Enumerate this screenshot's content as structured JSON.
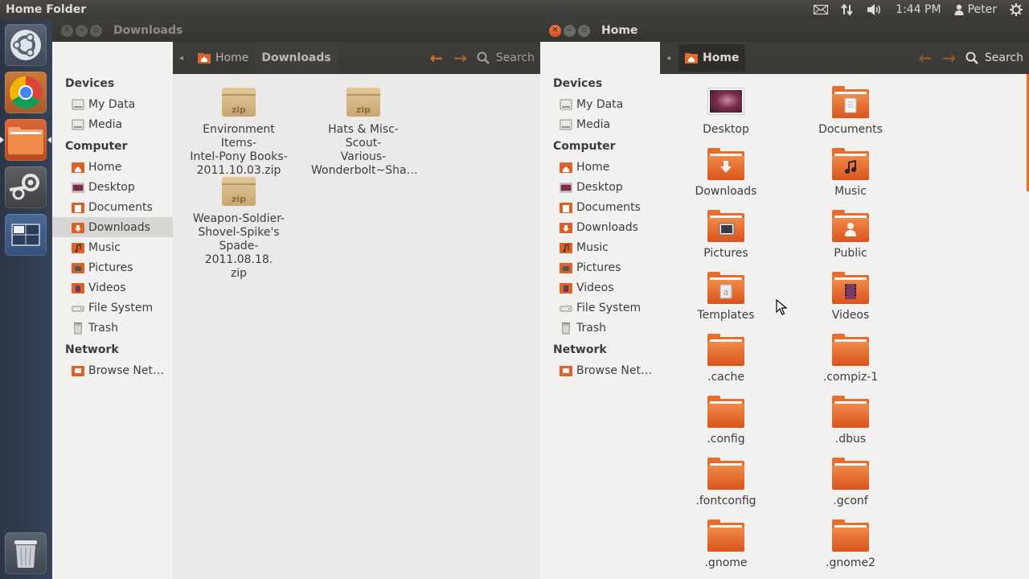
{
  "top_panel": {
    "title": "Home Folder",
    "time": "1:44 PM",
    "user": "Peter",
    "icons": [
      "mail-icon",
      "network-icon",
      "volume-icon",
      "user-icon",
      "gear-icon"
    ]
  },
  "launcher": {
    "items": [
      "ubuntu-dash",
      "chrome",
      "files",
      "steam",
      "workspace-switcher",
      "trash"
    ]
  },
  "left_window": {
    "title": "Downloads",
    "crumbs": [
      "Home",
      "Downloads"
    ],
    "search_label": "Search",
    "sidebar": {
      "devices_heading": "Devices",
      "devices": [
        "My Data",
        "Media"
      ],
      "computer_heading": "Computer",
      "computer": [
        "Home",
        "Desktop",
        "Documents",
        "Downloads",
        "Music",
        "Pictures",
        "Videos",
        "File System",
        "Trash"
      ],
      "network_heading": "Network",
      "network": [
        "Browse Net…"
      ]
    },
    "files": [
      {
        "name": "Environment Items-Intel-Pony Books-2011.10.03.zip",
        "lines": [
          "Environment Items-",
          "Intel-Pony Books-",
          "2011.10.03.zip"
        ]
      },
      {
        "name": "Hats & Misc-Scout-Various-Wonderbolt~Sha…",
        "lines": [
          "Hats & Misc-Scout-",
          "Various-",
          "Wonderbolt~Sha…"
        ]
      },
      {
        "name": "Weapon-Soldier-Shovel-Spike's Spade-2011.08.18.zip",
        "lines": [
          "Weapon-Soldier-",
          "Shovel-Spike's",
          "Spade-2011.08.18.",
          "zip"
        ]
      }
    ],
    "zip_label": "zip"
  },
  "right_window": {
    "title": "Home",
    "crumbs": [
      "Home"
    ],
    "search_label": "Search",
    "sidebar": {
      "devices_heading": "Devices",
      "devices": [
        "My Data",
        "Media"
      ],
      "computer_heading": "Computer",
      "computer": [
        "Home",
        "Desktop",
        "Documents",
        "Downloads",
        "Music",
        "Pictures",
        "Videos",
        "File System",
        "Trash"
      ],
      "network_heading": "Network",
      "network": [
        "Browse Net…"
      ]
    },
    "folders": [
      "Desktop",
      "Documents",
      "Downloads",
      "Music",
      "Pictures",
      "Public",
      "Templates",
      "Videos",
      ".cache",
      ".compiz-1",
      ".config",
      ".dbus",
      ".fontconfig",
      ".gconf",
      ".gnome",
      ".gnome2"
    ]
  },
  "colors": {
    "accent_orange": "#e66d2e",
    "panel_dark": "#3c3b37",
    "launcher_blue": "#354257"
  }
}
